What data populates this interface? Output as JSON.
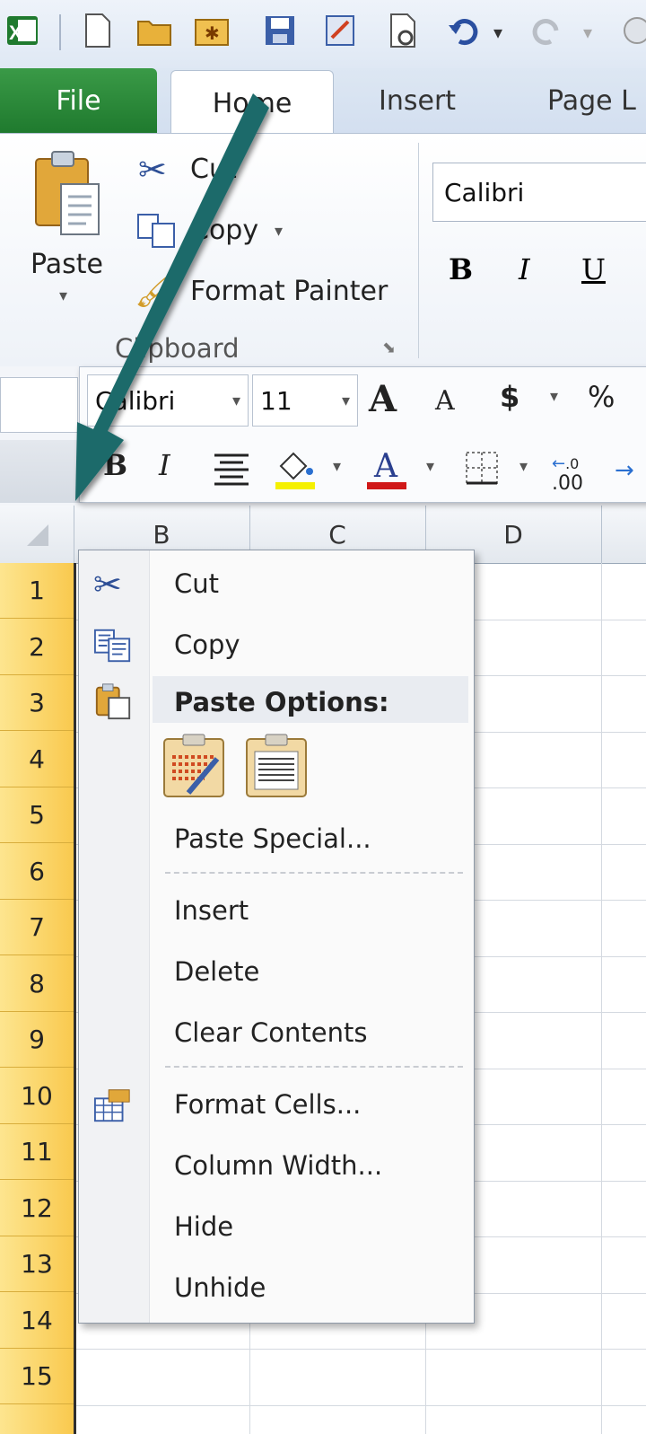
{
  "tabs": {
    "file": "File",
    "home": "Home",
    "insert": "Insert",
    "page_layout": "Page L"
  },
  "ribbon": {
    "paste": "Paste",
    "cut": "Cut",
    "copy": "Copy",
    "format_painter": "Format Painter",
    "clipboard_group": "Clipboard",
    "font_name": "Calibri",
    "bold": "B",
    "italic": "I",
    "underline": "U"
  },
  "mini_toolbar": {
    "font": "Calibri",
    "size": "11",
    "grow": "A",
    "shrink": "A",
    "currency": "$",
    "percent": "%",
    "bold": "B",
    "italic": "I",
    "decimals": ".00"
  },
  "columns": [
    "B",
    "C",
    "D"
  ],
  "rows": [
    "1",
    "2",
    "3",
    "4",
    "5",
    "6",
    "7",
    "8",
    "9",
    "10",
    "11",
    "12",
    "13",
    "14",
    "15"
  ],
  "context_menu": {
    "cut": "Cut",
    "copy": "Copy",
    "paste_options": "Paste Options:",
    "paste_special": "Paste Special...",
    "insert": "Insert",
    "delete": "Delete",
    "clear_contents": "Clear Contents",
    "format_cells": "Format Cells...",
    "column_width": "Column Width...",
    "hide": "Hide",
    "unhide": "Unhide"
  },
  "colors": {
    "arrow": "#1d6b6b",
    "file_tab": "#2a8a3a",
    "row_highlight": "#fbd35f"
  }
}
